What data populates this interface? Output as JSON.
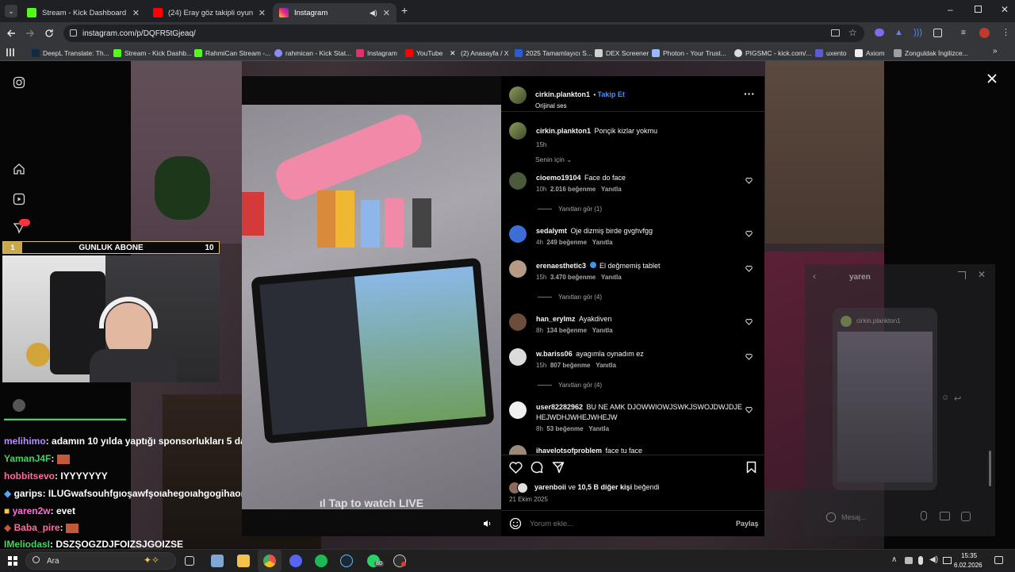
{
  "browser": {
    "tabs": [
      {
        "title": "Stream - Kick Dashboard",
        "favicon_color": "#53fc18"
      },
      {
        "title": "(24) Eray göz takipli oyun oyna",
        "favicon_color": "#ff0000"
      },
      {
        "title": "Instagram",
        "favicon_color": "#e1306c"
      }
    ],
    "url": "instagram.com/p/DQFR5tGjeaq/",
    "bookmarks": [
      {
        "label": "DeepL Translate: Th...",
        "color": "#0f2b46"
      },
      {
        "label": "Stream - Kick Dashb...",
        "color": "#53fc18"
      },
      {
        "label": "RahmiCan Stream -...",
        "color": "#53fc18"
      },
      {
        "label": "rahmican - Kick Stat...",
        "color": "#8b8cf0"
      },
      {
        "label": "Instagram",
        "color": "#e1306c"
      },
      {
        "label": "YouTube",
        "color": "#ff0000"
      },
      {
        "label": "(2) Anasayfa / X",
        "color": "#ffffff"
      },
      {
        "label": "2025 Tamamlayıcı S...",
        "color": "#2a5bd7"
      },
      {
        "label": "DEX Screener",
        "color": "#d0d0d0"
      },
      {
        "label": "Photon - Your Trust...",
        "color": "#9ab6ff"
      },
      {
        "label": "PIGSMC - kick.com/...",
        "color": "#dddddd"
      },
      {
        "label": "uxento",
        "color": "#5b5bd6"
      },
      {
        "label": "Axiom",
        "color": "#eeeeee"
      },
      {
        "label": "Zonguldak İngilizce...",
        "color": "#9aa0a6"
      }
    ]
  },
  "stream_overlay": {
    "abone_count_left": "1",
    "abone_label": "GUNLUK ABONE",
    "abone_count_right": "10",
    "chat": [
      {
        "user": "melihimo",
        "color": "#b88cff",
        "text": ": adamın 10 yılda yaptığı sponsorlukları 5 dakika reklam ettin malcan"
      },
      {
        "user": "YamanJ4F",
        "color": "#46d160",
        "text": ":"
      },
      {
        "user": "hobbitsevo",
        "color": "#ff6b9c",
        "text": ": IYYYYYYY"
      },
      {
        "user": "garips",
        "color": "#ffffff",
        "text": ": ILUGwafsouhfgıoşawfşoıahegoıahgogihaoıpgagpıh"
      },
      {
        "user": "yaren2w",
        "color": "#ff6bd5",
        "text": ": evet"
      },
      {
        "user": "Baba_pire",
        "color": "#ff6b9c",
        "text": ":"
      },
      {
        "user": "IMeliodasI",
        "color": "#46d160",
        "text": ": DSZŞOGZDJFOIZSJGOIZSE"
      }
    ]
  },
  "video": {
    "tap_to_watch": "Tap to watch LIVE"
  },
  "post": {
    "author": "cirkin.plankton1",
    "follow_label": "Takip Et",
    "audio": "Orijinal ses",
    "caption_user": "cirkin.plankton1",
    "caption_text": "Ponçik kizlar yokmu",
    "caption_time": "15h",
    "sort_label": "Senin için",
    "comments": [
      {
        "user": "cioemo19104",
        "text": "Face do face",
        "time": "10h",
        "likes": "2.016 beğenme",
        "reply": "Yanıtla",
        "replies": "Yanıtları gör (1)",
        "avatar_color": "#4a5a3a"
      },
      {
        "user": "sedalymt",
        "text": "Oje dizmiş birde gvghvfgg",
        "time": "4h",
        "likes": "249 beğenme",
        "reply": "Yanıtla",
        "replies": "",
        "avatar_color": "#3c6ed8"
      },
      {
        "user": "erenaesthetic3",
        "text": "El değmemiş tablet",
        "time": "15h",
        "likes": "3.470 beğenme",
        "reply": "Yanıtla",
        "replies": "Yanıtları gör (4)",
        "avatar_color": "#b79a86",
        "verified": true
      },
      {
        "user": "han_erylmz",
        "text": "Ayakdiven",
        "time": "8h",
        "likes": "134 beğenme",
        "reply": "Yanıtla",
        "replies": "",
        "avatar_color": "#6a4d3a"
      },
      {
        "user": "w.bariss06",
        "text": "ayagımla oynadım ez",
        "time": "15h",
        "likes": "807 beğenme",
        "reply": "Yanıtla",
        "replies": "Yanıtları gör (4)",
        "avatar_color": "#dbdbdb"
      },
      {
        "user": "user82282962",
        "text": "BU NE AMK DJOWWIOWJSWKJSWOJDWJDJEHEJWDHJWHEJWHEJW",
        "time": "8h",
        "likes": "53 beğenme",
        "reply": "Yanıtla",
        "replies": "",
        "avatar_color": "#f0f0f0"
      },
      {
        "user": "ihavelotsofproblem",
        "text": "face tu face",
        "time": "",
        "likes": "",
        "reply": "",
        "replies": "",
        "avatar_color": "#9b8a7a"
      }
    ],
    "likes_prefix": "yarenboii",
    "likes_mid": " ve ",
    "likes_others": "10,5 B diğer kişi",
    "likes_suffix": " beğendi",
    "date": "21 Ekim 2025",
    "comment_placeholder": "Yorum ekle...",
    "post_button": "Paylaş"
  },
  "dm": {
    "title": "yaren",
    "shared_user": "cirkin.plankton1",
    "placeholder": "Mesaj..."
  },
  "taskbar": {
    "search_placeholder": "Ara",
    "whatsapp_badge": "80",
    "time": "15:35",
    "date": "6.02.2026"
  }
}
